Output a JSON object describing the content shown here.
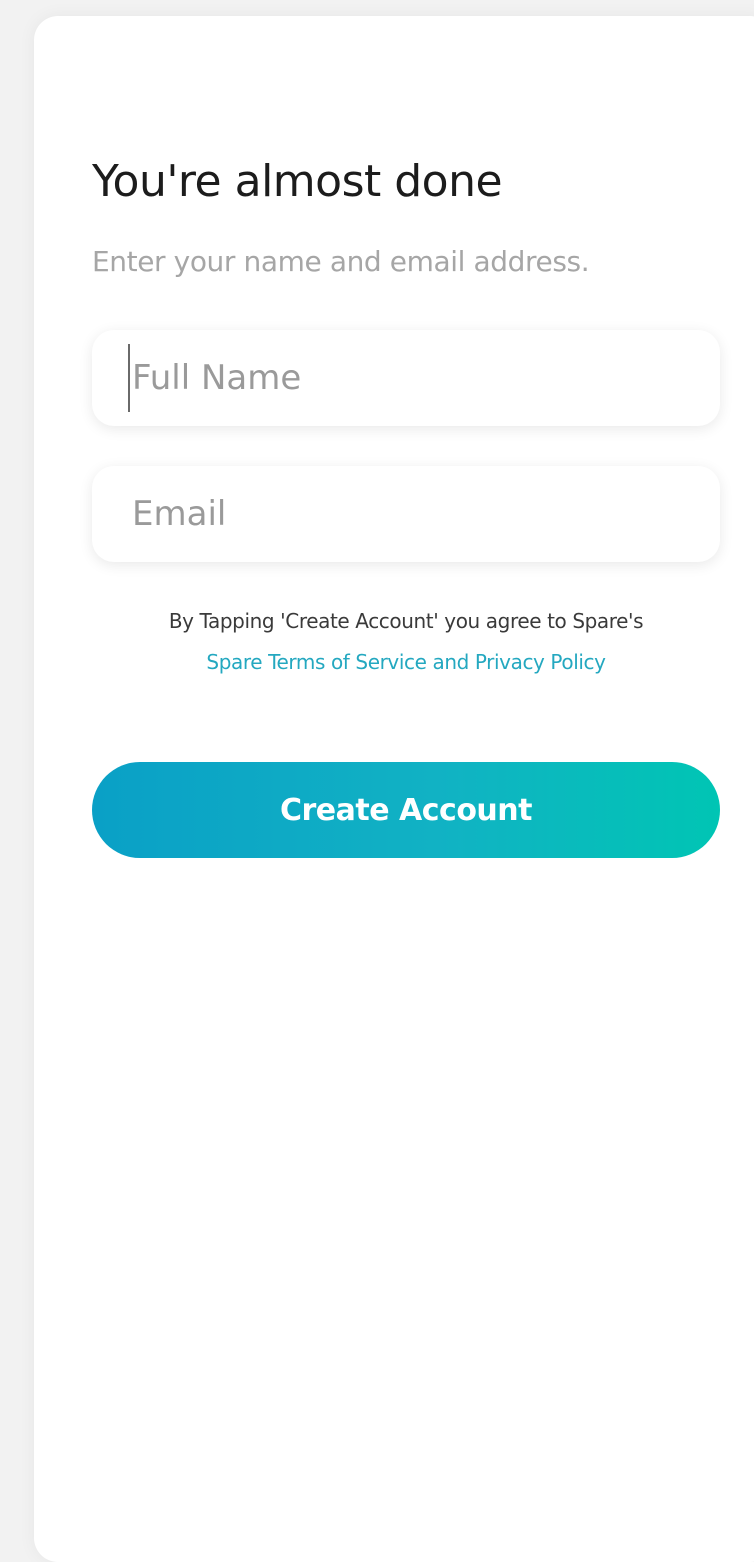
{
  "screen": {
    "title": "You're almost done",
    "subtitle": "Enter your name and email address."
  },
  "form": {
    "full_name": {
      "value": "",
      "placeholder": "Full Name"
    },
    "email": {
      "value": "",
      "placeholder": "Email"
    }
  },
  "terms": {
    "text": "By Tapping 'Create Account' you agree to Spare's",
    "link_text": "Spare Terms of Service and Privacy Policy"
  },
  "actions": {
    "create_account_label": "Create Account"
  },
  "colors": {
    "accent_start": "#0aa0c6",
    "accent_end": "#00c5b4",
    "link": "#24a8c0"
  }
}
